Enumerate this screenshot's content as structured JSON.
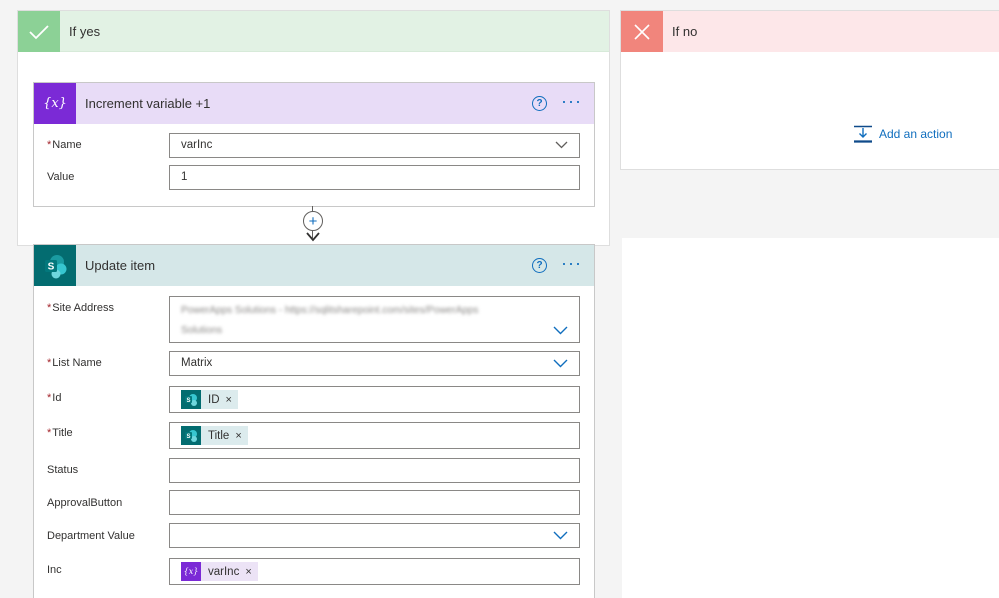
{
  "yes_branch": {
    "title": "If yes"
  },
  "no_branch": {
    "title": "If no",
    "add_action_label": "Add an action"
  },
  "increment_card": {
    "title": "Increment variable +1",
    "help_glyph": "?",
    "more_glyph": "···",
    "icon_glyph": "{x}",
    "name_label": "Name",
    "name_value": "varInc",
    "value_label": "Value",
    "value_value": "1",
    "accent_color": "#7b2ad6"
  },
  "connector": {
    "plus_glyph": "+"
  },
  "update_card": {
    "title": "Update item",
    "help_glyph": "?",
    "more_glyph": "···",
    "accent_color": "#036c70",
    "fields": {
      "site_address": {
        "label": "Site Address",
        "value_line1": "PowerApps Solutions - https://sqlitsharepoint.com/sites/PowerApps",
        "value_line2": "Solutions"
      },
      "list_name": {
        "label": "List Name",
        "value": "Matrix"
      },
      "id": {
        "label": "Id",
        "token": "ID"
      },
      "title": {
        "label": "Title",
        "token": "Title"
      },
      "status": {
        "label": "Status",
        "value": ""
      },
      "approval_button": {
        "label": "ApprovalButton",
        "value": ""
      },
      "department_value": {
        "label": "Department Value",
        "value": ""
      },
      "inc": {
        "label": "Inc",
        "token": "varInc"
      }
    },
    "token_remove_glyph": "×"
  }
}
